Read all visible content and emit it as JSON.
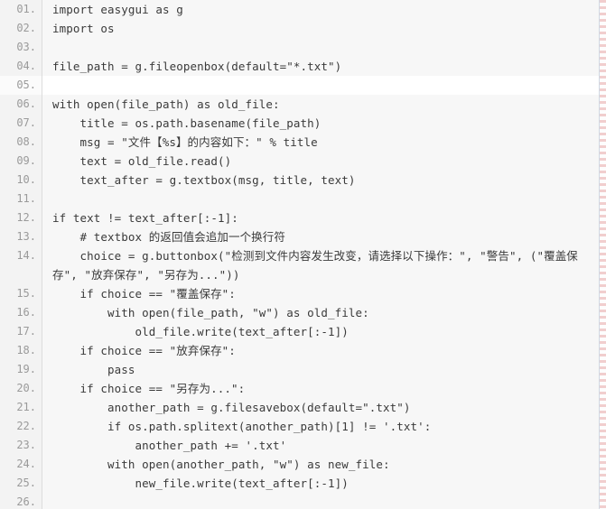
{
  "editor": {
    "kind": "code-listing",
    "language": "Python",
    "line_number_suffix": ".",
    "current_line": 5,
    "colors": {
      "background": "#f7f7f7",
      "current_line_background": "#ffffff",
      "gutter_background": "#f3f3f3",
      "gutter_text": "#9a9a9a",
      "code_text": "#3a3a3a",
      "gutter_divider": "#dcdcdc",
      "right_rule": "#cfd8e3",
      "page_edge": "#f0c8c8"
    },
    "lines": [
      {
        "number": "01.",
        "code": "import easygui as g"
      },
      {
        "number": "02.",
        "code": "import os"
      },
      {
        "number": "03.",
        "code": ""
      },
      {
        "number": "04.",
        "code": "file_path = g.fileopenbox(default=\"*.txt\")"
      },
      {
        "number": "05.",
        "code": ""
      },
      {
        "number": "06.",
        "code": "with open(file_path) as old_file:"
      },
      {
        "number": "07.",
        "code": "    title = os.path.basename(file_path)"
      },
      {
        "number": "08.",
        "code": "    msg = \"文件【%s】的内容如下：\" % title"
      },
      {
        "number": "09.",
        "code": "    text = old_file.read()"
      },
      {
        "number": "10.",
        "code": "    text_after = g.textbox(msg, title, text)"
      },
      {
        "number": "11.",
        "code": ""
      },
      {
        "number": "12.",
        "code": "if text != text_after[:-1]:"
      },
      {
        "number": "13.",
        "code": "    # textbox 的返回值会追加一个换行符"
      },
      {
        "number": "14.",
        "code": "    choice = g.buttonbox(\"检测到文件内容发生改变，请选择以下操作：\", \"警告\", (\"覆盖保存\", \"放弃保存\", \"另存为...\"))"
      },
      {
        "number": "15.",
        "code": "    if choice == \"覆盖保存\":"
      },
      {
        "number": "16.",
        "code": "        with open(file_path, \"w\") as old_file:"
      },
      {
        "number": "17.",
        "code": "            old_file.write(text_after[:-1])"
      },
      {
        "number": "18.",
        "code": "    if choice == \"放弃保存\":"
      },
      {
        "number": "19.",
        "code": "        pass"
      },
      {
        "number": "20.",
        "code": "    if choice == \"另存为...\":"
      },
      {
        "number": "21.",
        "code": "        another_path = g.filesavebox(default=\".txt\")"
      },
      {
        "number": "22.",
        "code": "        if os.path.splitext(another_path)[1] != '.txt':"
      },
      {
        "number": "23.",
        "code": "            another_path += '.txt'"
      },
      {
        "number": "24.",
        "code": "        with open(another_path, \"w\") as new_file:"
      },
      {
        "number": "25.",
        "code": "            new_file.write(text_after[:-1])"
      },
      {
        "number": "26.",
        "code": ""
      }
    ]
  }
}
